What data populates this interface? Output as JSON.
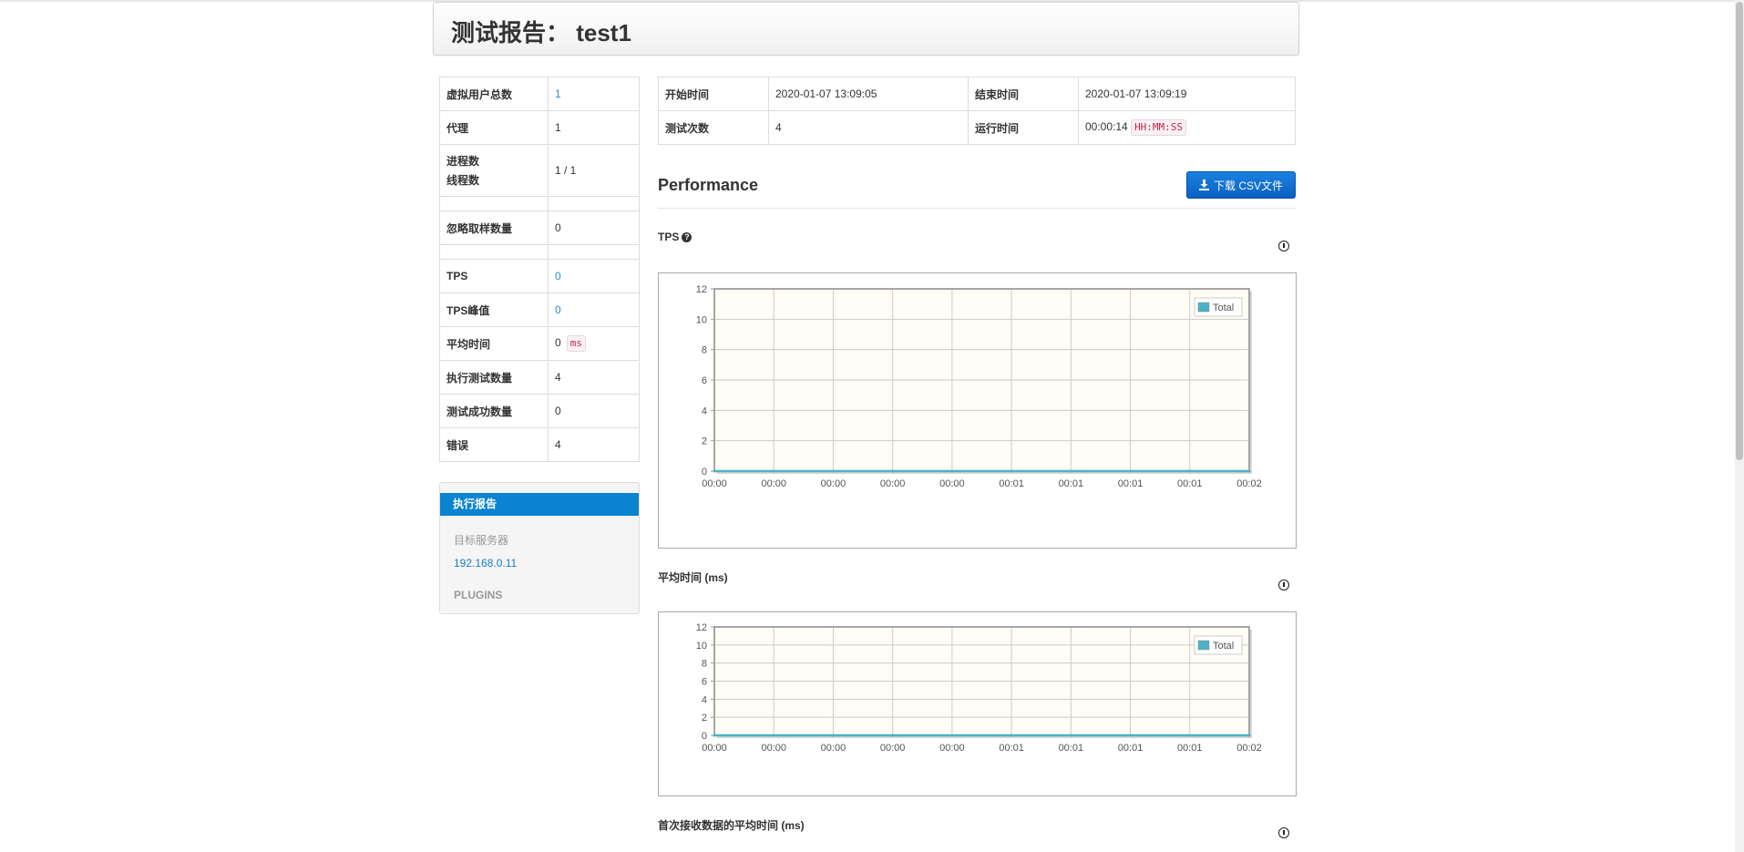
{
  "header": {
    "title": "测试报告： test1"
  },
  "summary": [
    {
      "label": "虚拟用户总数",
      "value": "1",
      "blue": true
    },
    {
      "label": "代理",
      "value": "1"
    },
    {
      "label": "进程数",
      "label2": "线程数",
      "value": "1 / 1"
    },
    {
      "spacer": true
    },
    {
      "label": "忽略取样数量",
      "value": "0"
    },
    {
      "spacer": true
    },
    {
      "label": "TPS",
      "value": "0",
      "blue": true
    },
    {
      "label": "TPS峰值",
      "value": "0",
      "blue": true
    },
    {
      "label": "平均时间",
      "value": "0",
      "unit": "ms"
    },
    {
      "label": "执行测试数量",
      "value": "4"
    },
    {
      "label": "测试成功数量",
      "value": "0"
    },
    {
      "label": "错误",
      "value": "4"
    }
  ],
  "nav": {
    "active": "执行报告",
    "target_heading": "目标服务器",
    "target_link": "192.168.0.11",
    "plugins_heading": "PLUGINS"
  },
  "info": {
    "start_label": "开始时间",
    "start_value": "2020-01-07 13:09:05",
    "end_label": "结束时间",
    "end_value": "2020-01-07 13:09:19",
    "count_label": "测试次数",
    "count_value": "4",
    "run_label": "运行时间",
    "run_value": "00:00:14",
    "run_unit": "HH:MM:SS"
  },
  "performance": {
    "title": "Performance",
    "download_label": "下载 CSV文件"
  },
  "sections": {
    "tps": "TPS",
    "avg_time": "平均时间 (ms)",
    "first_byte": "首次接收数据的平均时间 (ms)"
  },
  "colors": {
    "series": "#4bb2c5",
    "plot_bg": "#fffdf6",
    "button": "#0b6fd3"
  },
  "icons": {
    "download": "download-icon",
    "help": "help-icon",
    "chart_control": "chart-control-icon"
  },
  "chart_data": [
    {
      "type": "line",
      "categories": [
        "00:00",
        "00:00",
        "00:00",
        "00:00",
        "00:00",
        "00:01",
        "00:01",
        "00:01",
        "00:01",
        "00:02"
      ],
      "series": [
        {
          "name": "Total",
          "values": [
            0,
            0,
            0,
            0,
            0,
            0,
            0,
            0,
            0,
            0
          ]
        }
      ],
      "yticks": [
        "0",
        "2",
        "4",
        "6",
        "8",
        "10",
        "12"
      ],
      "ylim": [
        0,
        12
      ],
      "grid": true,
      "legend": "top-right"
    },
    {
      "type": "line",
      "categories": [
        "00:00",
        "00:00",
        "00:00",
        "00:00",
        "00:00",
        "00:01",
        "00:01",
        "00:01",
        "00:01",
        "00:02"
      ],
      "series": [
        {
          "name": "Total",
          "values": [
            0,
            0,
            0,
            0,
            0,
            0,
            0,
            0,
            0,
            0
          ]
        }
      ],
      "yticks": [
        "0",
        "2",
        "4",
        "6",
        "8",
        "10",
        "12"
      ],
      "ylim": [
        0,
        12
      ],
      "grid": true,
      "legend": "top-right"
    }
  ]
}
